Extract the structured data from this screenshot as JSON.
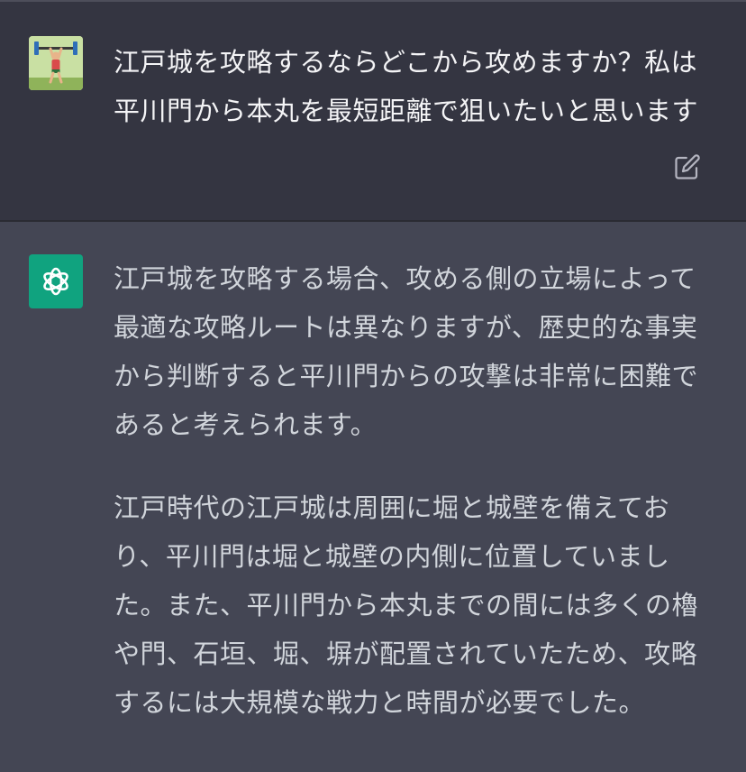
{
  "conversation": {
    "user_message": {
      "avatar_icon": "weightlifter-avatar-icon",
      "text": "江戸城を攻略するならどこから攻めますか？私は平川門から本丸を最短距離で狙いたいと思います",
      "edit_icon": "edit-icon"
    },
    "assistant_message": {
      "avatar_icon": "openai-logo-icon",
      "paragraphs": [
        "江戸城を攻略する場合、攻める側の立場によって最適な攻略ルートは異なりますが、歴史的な事実から判断すると平川門からの攻撃は非常に困難であると考えられます。",
        "江戸時代の江戸城は周囲に堀と城壁を備えており、平川門は堀と城壁の内側に位置していました。また、平川門から本丸までの間には多くの櫓や門、石垣、堀、塀が配置されていたため、攻略するには大規模な戦力と時間が必要でした。"
      ]
    }
  },
  "colors": {
    "user_bg": "#343541",
    "assistant_bg": "#444654",
    "brand": "#10a37f",
    "text": "#d1d5db"
  }
}
